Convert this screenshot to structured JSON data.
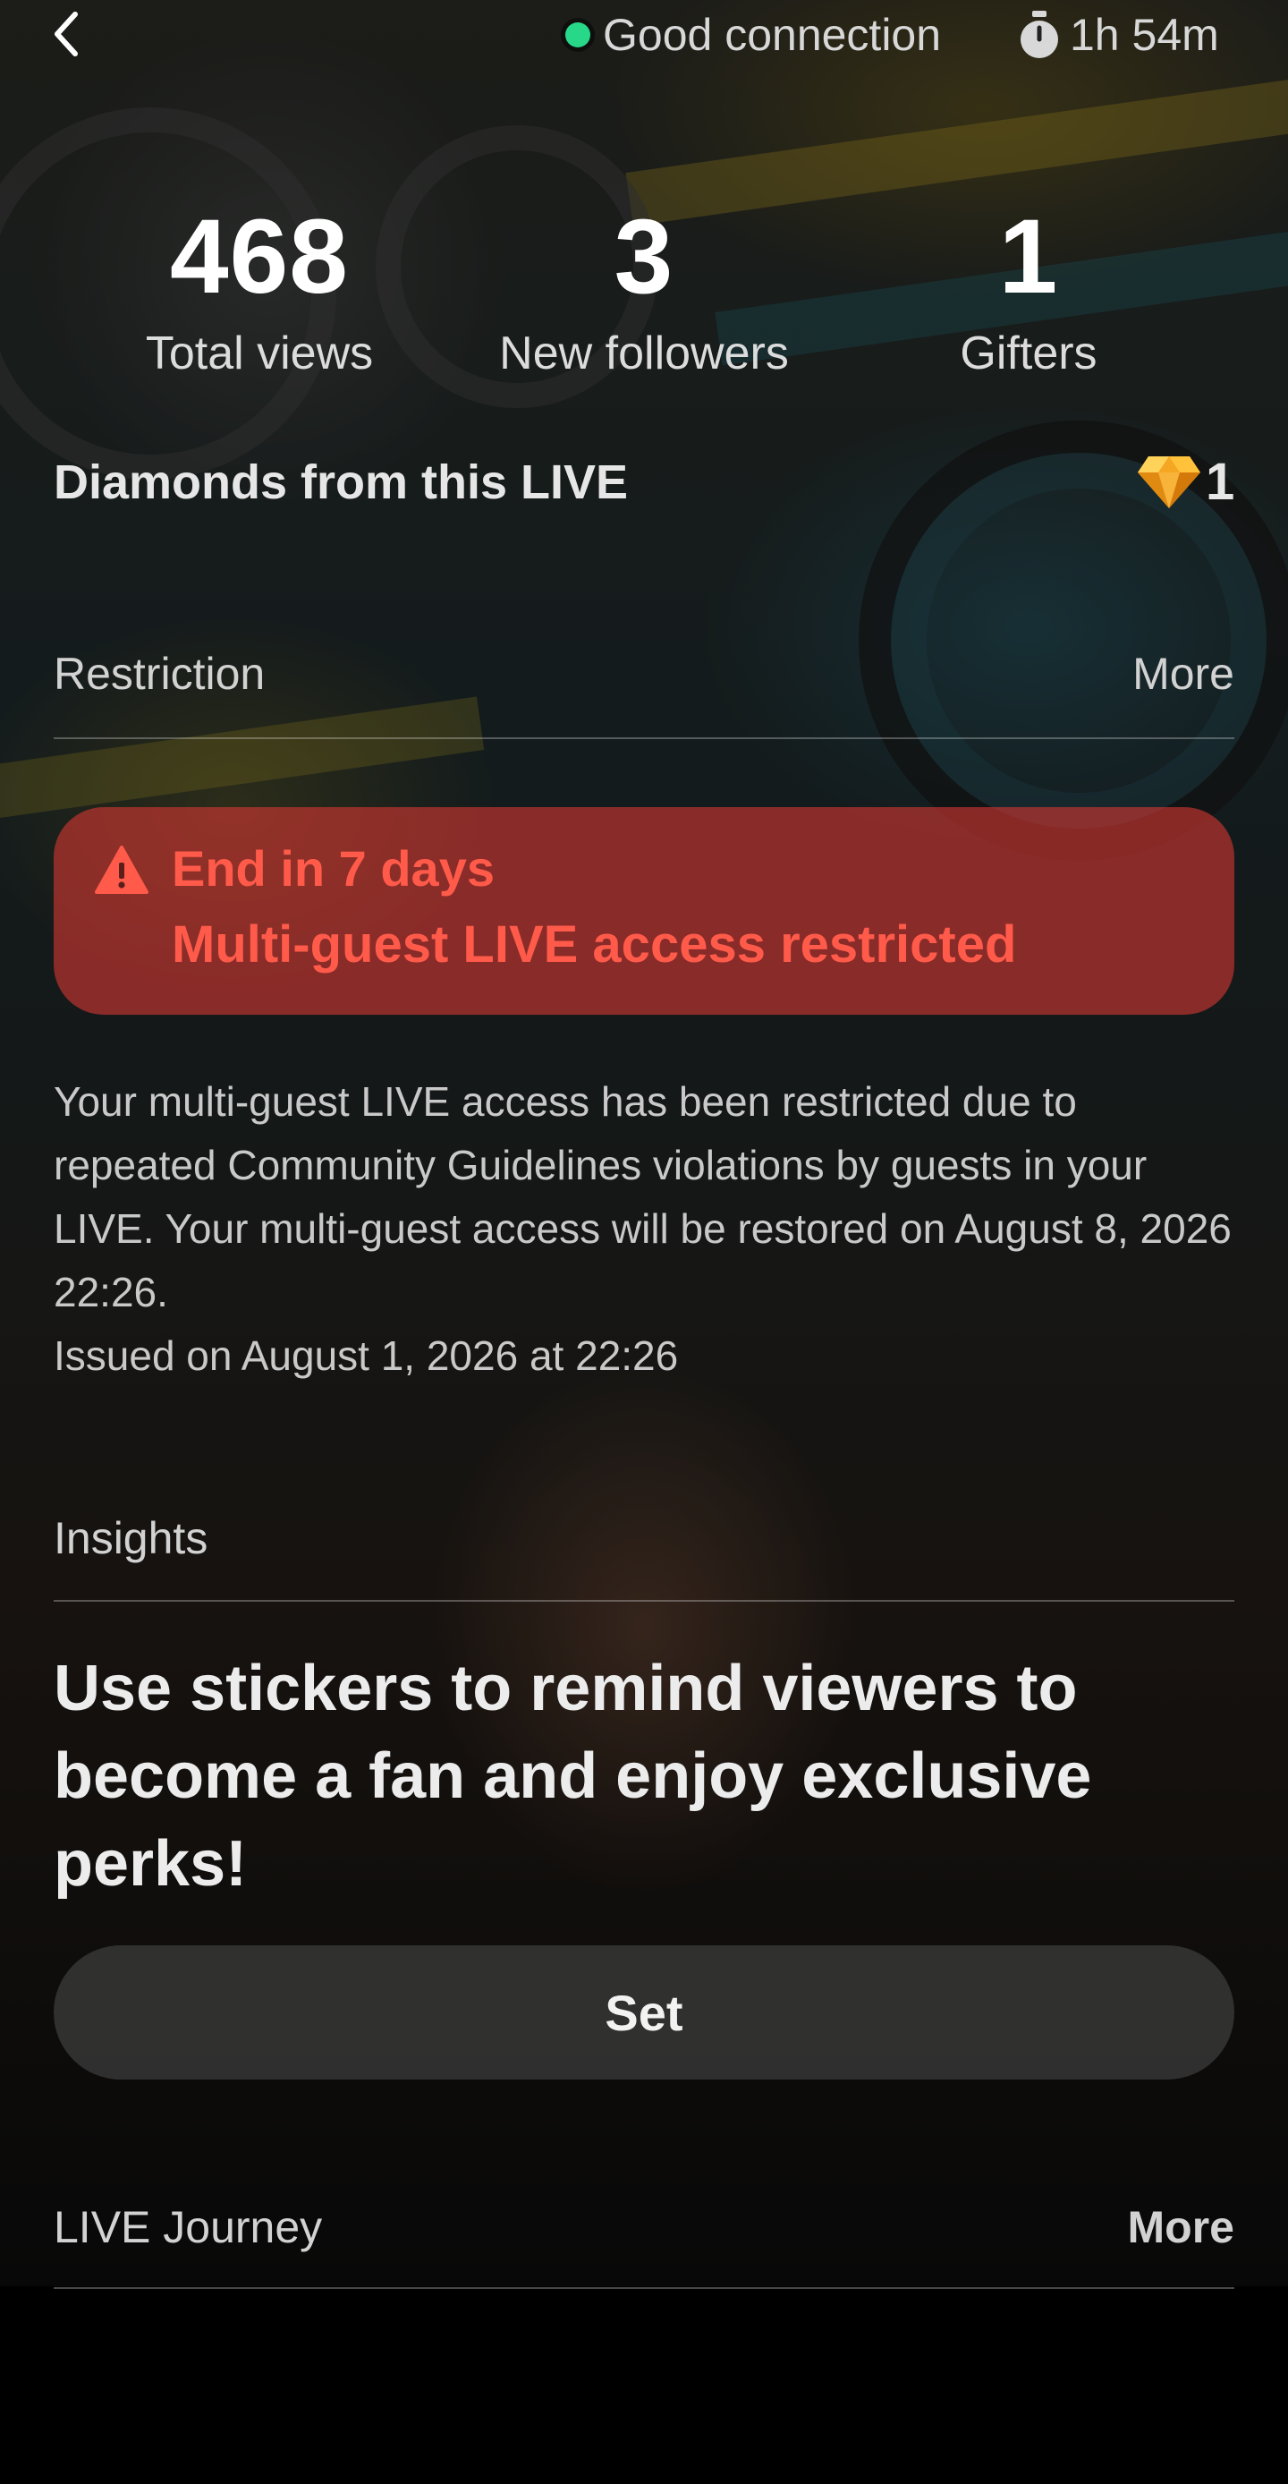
{
  "status": {
    "connection_text": "Good connection",
    "connection_color": "#27d889",
    "timer_text": "1h 54m",
    "icons": {
      "back": "chevron-left-icon",
      "timer": "stopwatch-icon"
    }
  },
  "stats": [
    {
      "value": "468",
      "label": "Total views"
    },
    {
      "value": "3",
      "label": "New followers"
    },
    {
      "value": "1",
      "label": "Gifters"
    }
  ],
  "diamonds": {
    "title": "Diamonds from this LIVE",
    "value": "1",
    "icon": "diamond-icon"
  },
  "restriction": {
    "title": "Restriction",
    "more_label": "More",
    "alert": {
      "icon": "warning-icon",
      "line1": "End in 7 days",
      "line2": "Multi-guest LIVE access restricted",
      "color": "#ff5a4a"
    },
    "description": "Your multi-guest LIVE access has been restricted due to repeated Community Guidelines violations by guests in your LIVE. Your multi-guest access will be restored on August 8, 2026 22:26.",
    "issued": "Issued on August 1, 2026 at 22:26"
  },
  "insights": {
    "title": "Insights",
    "headline": "Use stickers to remind viewers to become a fan and enjoy exclusive perks!",
    "button_label": "Set"
  },
  "journey": {
    "title": "LIVE Journey",
    "more_label": "More"
  }
}
